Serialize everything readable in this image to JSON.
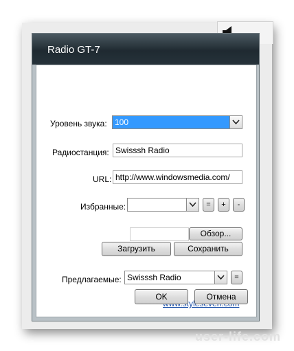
{
  "window": {
    "title": "Radio GT-7"
  },
  "speaker_icon": "speaker-icon",
  "volume": {
    "label": "Уровень звука:",
    "value": "100"
  },
  "station": {
    "label": "Радиостанция:",
    "value": "Swisssh Radio"
  },
  "url": {
    "label": "URL:",
    "value": "http://www.windowsmedia.com/"
  },
  "favorites": {
    "label": "Избранные:",
    "value": "",
    "eq_button": "=",
    "plus_button": "+",
    "minus_button": "-"
  },
  "browse": {
    "value": "",
    "button": "Обзор..."
  },
  "actions": {
    "load": "Загрузить",
    "save": "Сохранить"
  },
  "suggested": {
    "label": "Предлагаемые:",
    "value": "Swisssh Radio",
    "eq_button": "="
  },
  "link": "www.styleseven.com",
  "footer": {
    "ok": "OK",
    "cancel": "Отмена"
  },
  "watermark": "user-life.com",
  "colors": {
    "selection": "#3399ff",
    "titlebar": "#1f2a31",
    "link": "#1a4fa8"
  }
}
